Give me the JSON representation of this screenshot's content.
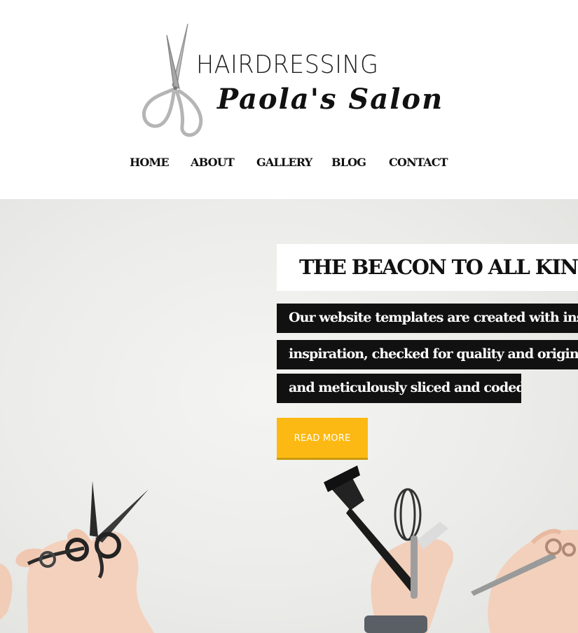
{
  "logo": {
    "line1": "HAIRDRESSING",
    "line2": "Paola's Salon"
  },
  "nav": [
    {
      "label": "HOME"
    },
    {
      "label": "ABOUT"
    },
    {
      "label": "GALLERY"
    },
    {
      "label": "BLOG"
    },
    {
      "label": "CONTACT"
    }
  ],
  "hero": {
    "title": "THE BEACON TO ALL KIND",
    "lines": [
      "Our website templates are created with inspir",
      "inspiration, checked for quality and originalit",
      "and meticulously sliced and coded"
    ],
    "button_label": "READ MORE"
  },
  "colors": {
    "accent": "#fdb913",
    "text_dark": "#111111",
    "hero_bg": "#ececea"
  }
}
